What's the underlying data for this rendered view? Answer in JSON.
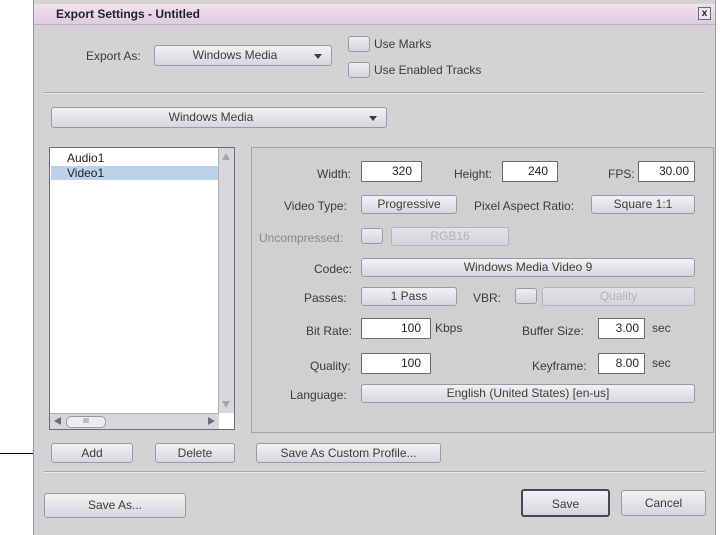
{
  "window": {
    "title": "Export Settings - Untitled",
    "close_glyph": "x"
  },
  "export_as": {
    "label": "Export As:",
    "value": "Windows Media"
  },
  "checkboxes": {
    "use_marks": "Use Marks",
    "use_enabled_tracks": "Use Enabled Tracks"
  },
  "format_menu": {
    "value": "Windows Media"
  },
  "tracks": {
    "items": [
      "Audio1",
      "Video1"
    ],
    "selected": "Video1",
    "scroll_thumb": "III"
  },
  "settings": {
    "width_label": "Width:",
    "width_value": "320",
    "height_label": "Height:",
    "height_value": "240",
    "fps_label": "FPS:",
    "fps_value": "30.00",
    "video_type_label": "Video Type:",
    "video_type_value": "Progressive",
    "pixel_aspect_label": "Pixel Aspect Ratio:",
    "pixel_aspect_value": "Square 1:1",
    "uncompressed_label": "Uncompressed:",
    "uncompressed_format": "RGB16",
    "codec_label": "Codec:",
    "codec_value": "Windows Media Video 9",
    "passes_label": "Passes:",
    "passes_value": "1 Pass",
    "vbr_label": "VBR:",
    "vbr_mode": "Quality",
    "bitrate_label": "Bit Rate:",
    "bitrate_value": "100",
    "bitrate_unit": "Kbps",
    "buffer_label": "Buffer Size:",
    "buffer_value": "3.00",
    "buffer_unit": "sec",
    "quality_label": "Quality:",
    "quality_value": "100",
    "keyframe_label": "Keyframe:",
    "keyframe_value": "8.00",
    "keyframe_unit": "sec",
    "language_label": "Language:",
    "language_value": "English (United States) [en-us]"
  },
  "buttons": {
    "add": "Add",
    "delete": "Delete",
    "save_custom_profile": "Save As Custom Profile...",
    "save_as": "Save As...",
    "save": "Save",
    "cancel": "Cancel"
  },
  "colors": {
    "titlebar": "#e6d6ea",
    "dialog_bg": "#d4d2d5",
    "selection": "#bcd2ea"
  }
}
